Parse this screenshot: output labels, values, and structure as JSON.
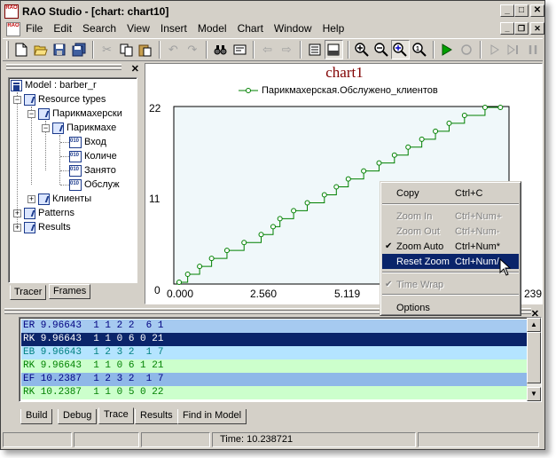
{
  "window": {
    "title": "RAO Studio - [chart: chart10]",
    "app_icon_text": "RAO"
  },
  "menu": [
    "File",
    "Edit",
    "Search",
    "View",
    "Insert",
    "Model",
    "Chart",
    "Window",
    "Help"
  ],
  "tree": {
    "root": "Model : barber_r",
    "resource_types": "Resource types",
    "rt_child": "Парикмахерски",
    "rt_grandchild": "Парикмахе",
    "params": [
      "Вход",
      "Количе",
      "Занято",
      "Обслуж"
    ],
    "clients": "Клиенты",
    "patterns": "Patterns",
    "results": "Results"
  },
  "left_tabs": [
    "Tracer",
    "Frames"
  ],
  "chart_data": {
    "type": "line",
    "title": "chart1",
    "series": [
      {
        "name": "Парикмахерская.Обслужено_клиентов",
        "color": "#008000",
        "step": true,
        "points": [
          [
            0,
            0
          ],
          [
            0.25,
            1
          ],
          [
            0.6,
            2
          ],
          [
            0.95,
            3
          ],
          [
            1.4,
            4
          ],
          [
            1.9,
            5
          ],
          [
            2.4,
            6
          ],
          [
            2.75,
            7
          ],
          [
            2.95,
            8
          ],
          [
            3.35,
            9
          ],
          [
            3.75,
            10
          ],
          [
            4.25,
            11
          ],
          [
            4.6,
            12
          ],
          [
            4.95,
            13
          ],
          [
            5.4,
            14
          ],
          [
            5.85,
            15
          ],
          [
            6.3,
            16
          ],
          [
            6.7,
            17
          ],
          [
            7.1,
            18
          ],
          [
            7.5,
            19
          ],
          [
            7.9,
            20
          ],
          [
            8.35,
            21
          ],
          [
            8.95,
            22
          ],
          [
            9.4,
            22
          ]
        ]
      }
    ],
    "yticks": [
      "22",
      "11",
      "0"
    ],
    "xticks": [
      "0.000",
      "2.560",
      "5.119",
      "239"
    ],
    "xlim": [
      0,
      9.6
    ],
    "ylim": [
      0,
      22
    ]
  },
  "context_menu": {
    "items": [
      {
        "label": "Copy",
        "shortcut": "Ctrl+C",
        "state": "normal"
      },
      {
        "label": "Zoom In",
        "shortcut": "Ctrl+Num+",
        "state": "disabled"
      },
      {
        "label": "Zoom Out",
        "shortcut": "Ctrl+Num-",
        "state": "disabled"
      },
      {
        "label": "Zoom Auto",
        "shortcut": "Ctrl+Num*",
        "state": "checked"
      },
      {
        "label": "Reset Zoom",
        "shortcut": "Ctrl+Num/",
        "state": "selected"
      },
      {
        "label": "Time Wrap",
        "shortcut": "",
        "state": "disabled-checked"
      },
      {
        "label": "Options",
        "shortcut": "",
        "state": "normal"
      }
    ]
  },
  "trace": {
    "rows": [
      {
        "text": "ER 9.96643  1 1 2 2  6 1",
        "bg": "#a6caf0",
        "fg": "#000080"
      },
      {
        "text": "RK 9.96643  1 1 0 6 0 21",
        "bg": "#0a246a",
        "fg": "#ffffff"
      },
      {
        "text": "EB 9.96643  1 2 3 2  1 7",
        "bg": "#b4e4ff",
        "fg": "#008080"
      },
      {
        "text": "RK 9.96643  1 1 0 6 1 21",
        "bg": "#ccffcc",
        "fg": "#008000"
      },
      {
        "text": "EF 10.2387  1 2 3 2  1 7",
        "bg": "#8fb8e8",
        "fg": "#000080"
      },
      {
        "text": "RK 10.2387  1 1 0 5 0 22",
        "bg": "#ccffcc",
        "fg": "#008000"
      }
    ]
  },
  "bottom_tabs": [
    "Build",
    "Debug",
    "Trace",
    "Results",
    "Find in Model"
  ],
  "status": {
    "time": "Time: 10.238721"
  }
}
